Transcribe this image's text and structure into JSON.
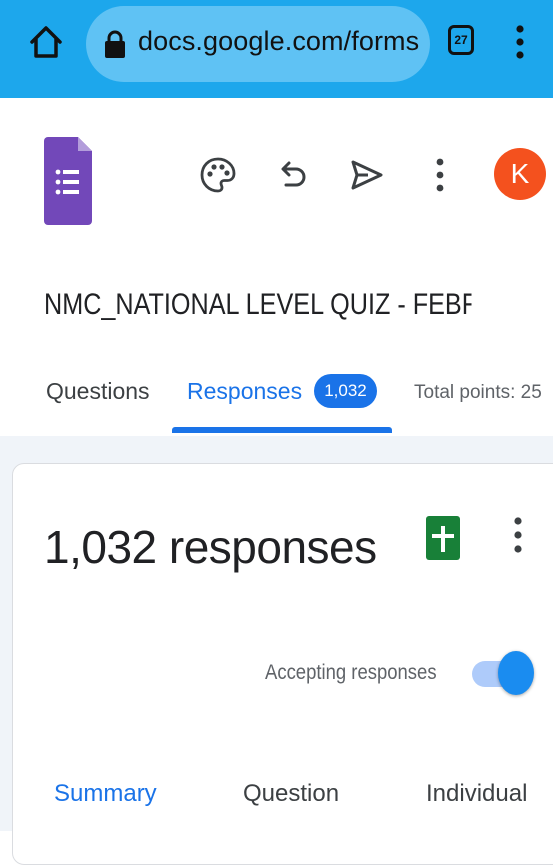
{
  "browser": {
    "url": "docs.google.com/forms",
    "tab_count": "27",
    "icons": {
      "home": "home-icon",
      "lock": "lock-icon",
      "tabs": "tabs-icon",
      "menu": "more-vert-icon"
    }
  },
  "header": {
    "icons": [
      "forms-logo-icon",
      "palette-icon",
      "undo-icon",
      "send-icon",
      "more-vert-icon"
    ],
    "avatar_letter": "K"
  },
  "form": {
    "title": "NMC_NATIONAL LEVEL QUIZ - FEBRUA"
  },
  "tabs": {
    "questions": "Questions",
    "responses": "Responses",
    "response_count": "1,032",
    "total_points": "Total points: 25"
  },
  "responses_card": {
    "heading": "1,032 responses",
    "accepting_label": "Accepting responses",
    "accepting_responses": true,
    "subtabs": {
      "summary": "Summary",
      "question": "Question",
      "individual": "Individual"
    }
  },
  "colors": {
    "browser_bar": "#1da7ec",
    "url_pill": "#5fc2f4",
    "accent": "#1a73e8",
    "forms_purple": "#7248b9",
    "avatar": "#f4511e",
    "sheets_green": "#188038"
  }
}
